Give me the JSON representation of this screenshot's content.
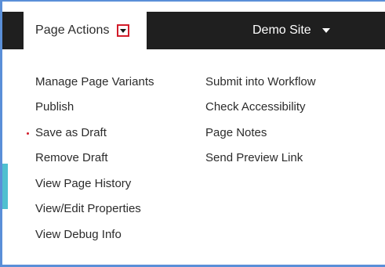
{
  "navbar": {
    "tab_label": "Page Actions",
    "site_name": "Demo Site"
  },
  "menu": {
    "left_column": [
      {
        "label": "Manage Page Variants",
        "active": false
      },
      {
        "label": "Publish",
        "active": false
      },
      {
        "label": "Save as Draft",
        "active": true
      },
      {
        "label": "Remove Draft",
        "active": false
      },
      {
        "label": "View Page History",
        "active": false
      },
      {
        "label": "View/Edit Properties",
        "active": false
      },
      {
        "label": "View Debug Info",
        "active": false
      }
    ],
    "right_column": [
      {
        "label": "Submit into Workflow"
      },
      {
        "label": "Check Accessibility"
      },
      {
        "label": "Page Notes"
      },
      {
        "label": "Send Preview Link"
      }
    ]
  },
  "colors": {
    "navbar_bg": "#1f1f1f",
    "accent_red": "#d21c2a",
    "frame_blue": "#5a8fd8",
    "teal": "#4fc0d0"
  },
  "icons": {
    "tab_caret": "chevron-down-icon",
    "site_caret": "chevron-down-icon",
    "active_marker": "dot-icon"
  }
}
